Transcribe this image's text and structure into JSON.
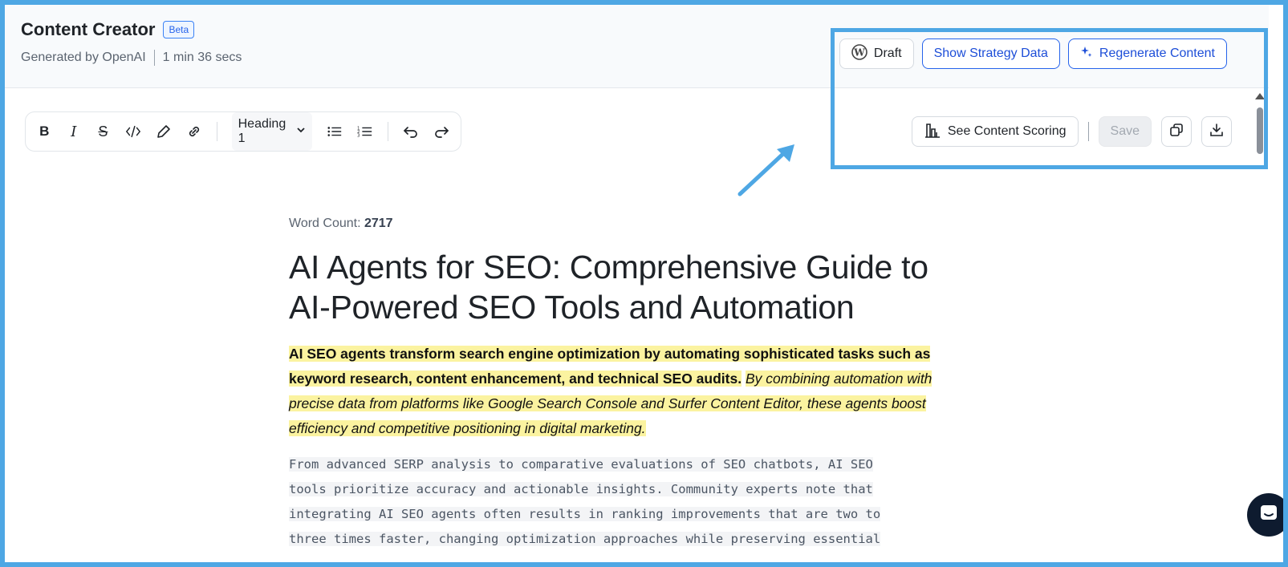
{
  "header": {
    "title": "Content Creator",
    "badge": "Beta",
    "generated_by": "Generated by OpenAI",
    "duration": "1 min 36 secs"
  },
  "actions": {
    "draft_label": "Draft",
    "strategy_label": "Show Strategy Data",
    "regenerate_label": "Regenerate Content"
  },
  "toolbar": {
    "heading_select": "Heading 1"
  },
  "secondary_actions": {
    "scoring_label": "See Content Scoring",
    "save_label": "Save"
  },
  "document": {
    "word_count_label": "Word Count:",
    "word_count": "2717",
    "title": "AI Agents for SEO: Comprehensive Guide to AI-Powered SEO Tools and Automation",
    "intro_bold": "AI SEO agents transform search engine optimization by automating sophisticated tasks such as keyword research, content enhancement, and technical SEO audits.",
    "intro_italic": "By combining automation with precise data from platforms like Google Search Console and Surfer Content Editor, these agents boost efficiency and competitive positioning in digital marketing.",
    "body_lines": [
      "From advanced SERP analysis to comparative evaluations of SEO chatbots, AI SEO",
      "tools prioritize accuracy and actionable insights. Community experts note that",
      "integrating AI SEO agents often results in ranking improvements that are two to",
      "three times faster, changing optimization approaches while preserving essential"
    ]
  },
  "colors": {
    "accent": "#2563eb",
    "annotation": "#4ea7e4",
    "highlight": "#fbf3a0"
  }
}
